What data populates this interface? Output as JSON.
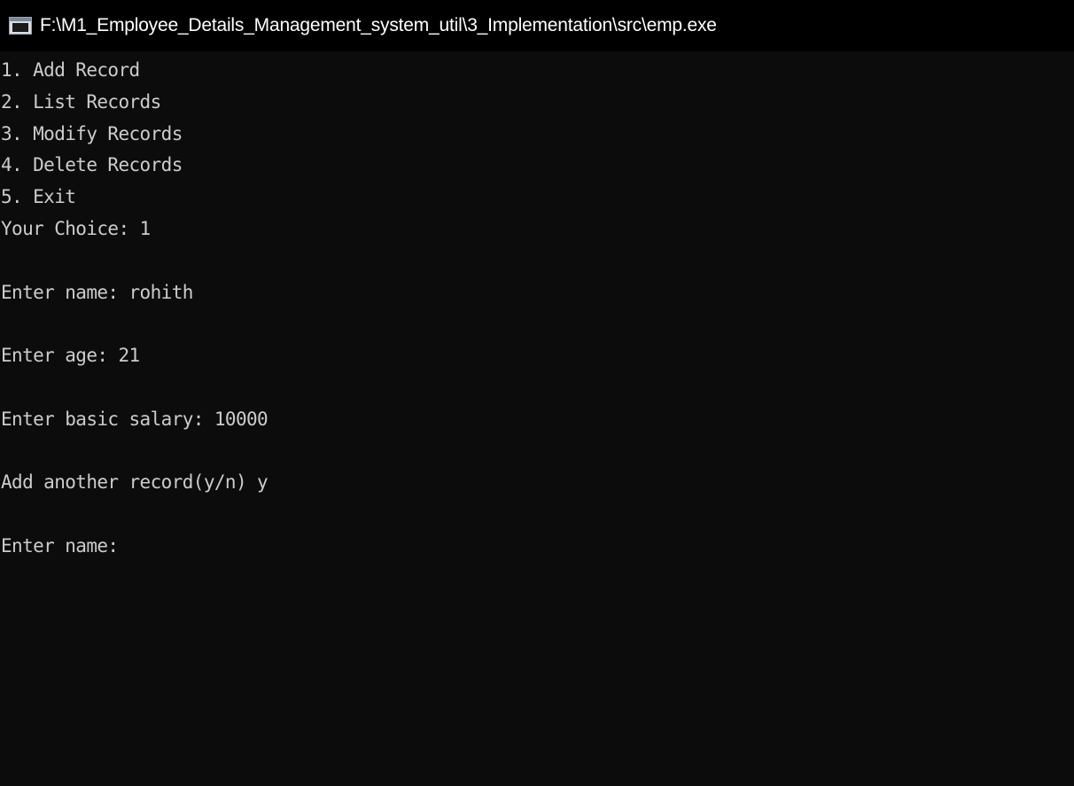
{
  "window": {
    "title": "F:\\M1_Employee_Details_Management_system_util\\3_Implementation\\src\\emp.exe",
    "icon": "console-window-icon"
  },
  "console": {
    "lines": [
      "1. Add Record",
      "2. List Records",
      "3. Modify Records",
      "4. Delete Records",
      "5. Exit",
      "Your Choice: 1",
      "",
      "Enter name: rohith",
      "",
      "Enter age: 21",
      "",
      "Enter basic salary: 10000",
      "",
      "Add another record(y/n) y",
      "",
      "Enter name:"
    ]
  },
  "colors": {
    "titlebar_bg": "#000000",
    "title_text": "#ffffff",
    "console_bg": "#0c0c0c",
    "console_text": "#cccccc"
  }
}
